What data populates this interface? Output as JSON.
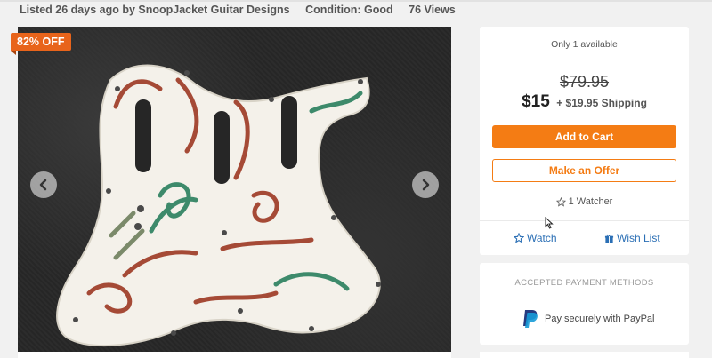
{
  "listing_meta": {
    "listed": "Listed 26 days ago by SnoopJacket Guitar Designs",
    "condition": "Condition: Good",
    "views": "76 Views"
  },
  "gallery": {
    "discount_badge": "82% OFF",
    "prev_icon": "chevron-left-icon",
    "next_icon": "chevron-right-icon"
  },
  "buy_box": {
    "availability": "Only 1 available",
    "original_price": "$79.95",
    "price": "$15",
    "shipping": "+ $19.95 Shipping",
    "add_to_cart": "Add to Cart",
    "make_offer": "Make an Offer",
    "watchers": "1 Watcher",
    "watch_label": "Watch",
    "wishlist_label": "Wish List",
    "accent_color": "#f47c14",
    "link_color": "#2b6fb5"
  },
  "payment": {
    "title": "ACCEPTED PAYMENT METHODS",
    "paypal_text": "Pay securely with PayPal",
    "icon": "paypal-icon"
  }
}
